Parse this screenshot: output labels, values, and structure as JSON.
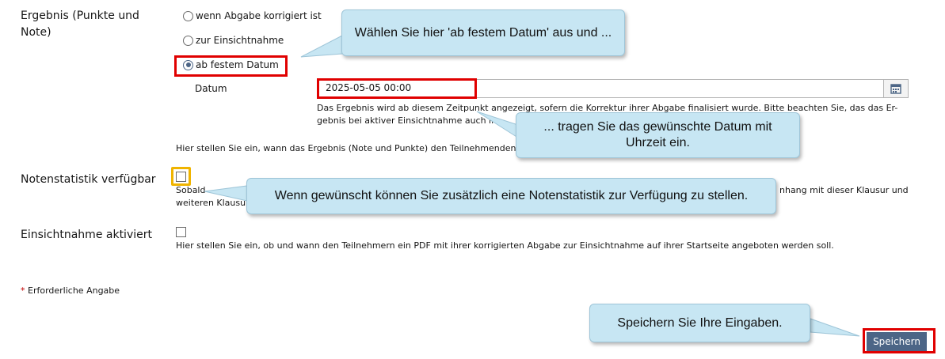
{
  "ergebnis": {
    "label": "Ergebnis (Punkte und Note)",
    "options": [
      "wenn Abgabe korrigiert ist",
      "zur Einsichtnahme",
      "ab festem Datum"
    ],
    "date_label": "Datum",
    "date_value": "2025-05-05 00:00",
    "help_date": "Das Ergebnis wird ab diesem Zeitpunkt angezeigt, sofern die Korrektur ihrer Abgabe finalisiert wurde. Bitte beachten Sie, das das Er-gebnis bei aktiver Einsichtnahme auch im",
    "help": "Hier stellen Sie ein, wann das Ergebnis (Note und Punkte) den Teilnehmenden"
  },
  "notenstatistik": {
    "label": "Notenstatistik verfügbar",
    "help_start": "Sobald",
    "help_end": "nhang mit dieser Klausur und",
    "help_line2": "weiteren Klausu"
  },
  "einsicht": {
    "label": "Einsichtnahme aktiviert",
    "help": "Hier stellen Sie ein, ob und wann den Teilnehmern ein PDF mit ihrer korrigierten Abgabe zur Einsichtnahme auf ihrer Startseite angeboten werden soll."
  },
  "required": {
    "star": "*",
    "text": "Erforderliche Angabe"
  },
  "save_label": "Speichern",
  "callouts": {
    "c1": "Wählen Sie hier 'ab festem Datum' aus und ...",
    "c2": "... tragen Sie das gewünschte Datum mit Uhrzeit ein.",
    "c3": "Wenn gewünscht können Sie zusätzlich eine Notenstatistik zur Verfügung zu stellen.",
    "c4": "Speichern Sie Ihre Eingaben."
  },
  "colors": {
    "primary": "#4c6586",
    "highlight_red": "#e00000",
    "highlight_yellow": "#f0b400",
    "callout_bg": "#c7e6f3"
  }
}
